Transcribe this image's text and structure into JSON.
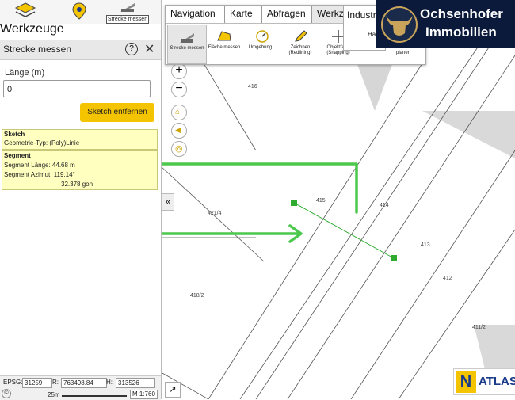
{
  "top_tabs": {
    "strecke_label": "Strecke messen"
  },
  "panel": {
    "title": "Werkzeuge",
    "tool_title": "Strecke messen",
    "laenge_label": "Länge (m)",
    "laenge_value": "0",
    "sketch_button": "Sketch entfernen",
    "sketch_heading": "Sketch",
    "geometrie": "Geometrie-Typ: (Poly)Linie",
    "segment_heading": "Segment",
    "segment_laenge": "Segment Länge:  44.68 m",
    "segment_azimut": "Segment Azimut: 119.14°",
    "gon": "32.378 gon"
  },
  "navbar": {
    "tabs": [
      "Navigation",
      "Karte",
      "Abfragen",
      "Werkz"
    ],
    "tools": [
      {
        "label": "Strecke messen",
        "icon": "ruler-icon"
      },
      {
        "label": "Fläche messen",
        "icon": "area-icon"
      },
      {
        "label": "Umgebung...",
        "icon": "compass-icon"
      },
      {
        "label": "Zeichnen (Redlining)",
        "icon": "pencil-icon"
      },
      {
        "label": "Objektfang (Snapping)",
        "icon": "snap-icon"
      }
    ]
  },
  "industry": {
    "label": "Industr",
    "sub": "Ha",
    "planen": "planen"
  },
  "logo": {
    "line1": "Ochsenhofer",
    "line2": "Immobilien"
  },
  "parcels": [
    "416",
    "415",
    "414",
    "413",
    "412",
    "421/4",
    "418/2",
    "411/2"
  ],
  "status": {
    "epsg_label": "EPSG:",
    "epsg": "31259",
    "r_label": "R:",
    "r": "763498.84",
    "h_label": "H:",
    "h": "313526",
    "scale_bar": "25m",
    "scale": "M 1:760"
  },
  "atlas": {
    "label": "ATLAS"
  },
  "colors": {
    "accent": "#f5c400",
    "arrow": "#4cc94c",
    "measure_line": "#2eaa2e"
  }
}
